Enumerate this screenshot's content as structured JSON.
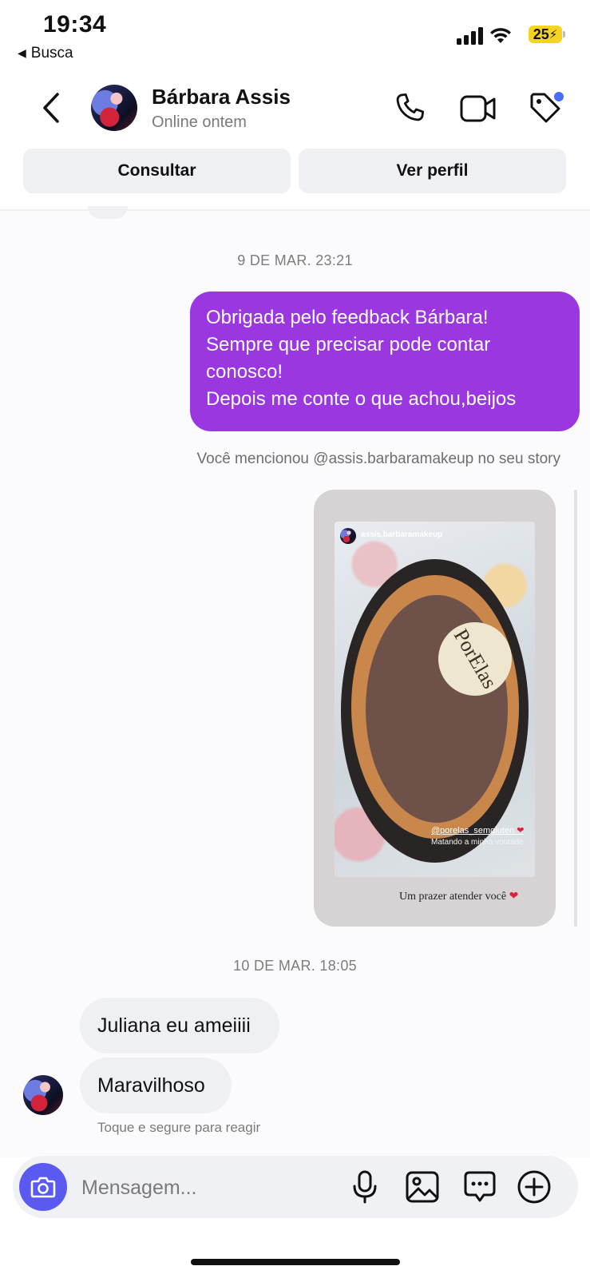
{
  "status_bar": {
    "time": "19:34",
    "back_app": "Busca",
    "battery": "25"
  },
  "header": {
    "contact_name": "Bárbara Assis",
    "contact_status": "Online ontem",
    "consult_label": "Consultar",
    "profile_label": "Ver perfil"
  },
  "chat": {
    "timestamp_1": "9 DE MAR. 23:21",
    "outgoing_message": {
      "line1": "Obrigada pelo feedback Bárbara!",
      "line2": "Sempre que precisar pode contar",
      "line3": "conosco!",
      "line4": "Depois me conte o que achou,beijos"
    },
    "mention_note": "Você mencionou @assis.barbaramakeup no seu story",
    "story": {
      "username": "assis.barbaramakeup",
      "logo_text": "PorElas",
      "tag": "@porelas_semgluten",
      "subtext": "Matando a minha vontade",
      "caption": "Um prazer atender você"
    },
    "timestamp_2": "10 DE MAR. 18:05",
    "incoming_1": "Juliana eu ameiiii",
    "incoming_2": "Maravilhoso",
    "react_hint": "Toque e segure para reagir"
  },
  "composer": {
    "placeholder": "Mensagem..."
  },
  "colors": {
    "outgoing_bubble": "#9a37e0",
    "incoming_bubble": "#eef0f3",
    "camera_button": "#5a5af0",
    "notification_dot": "#4b6cf5",
    "battery": "#f5d323"
  }
}
